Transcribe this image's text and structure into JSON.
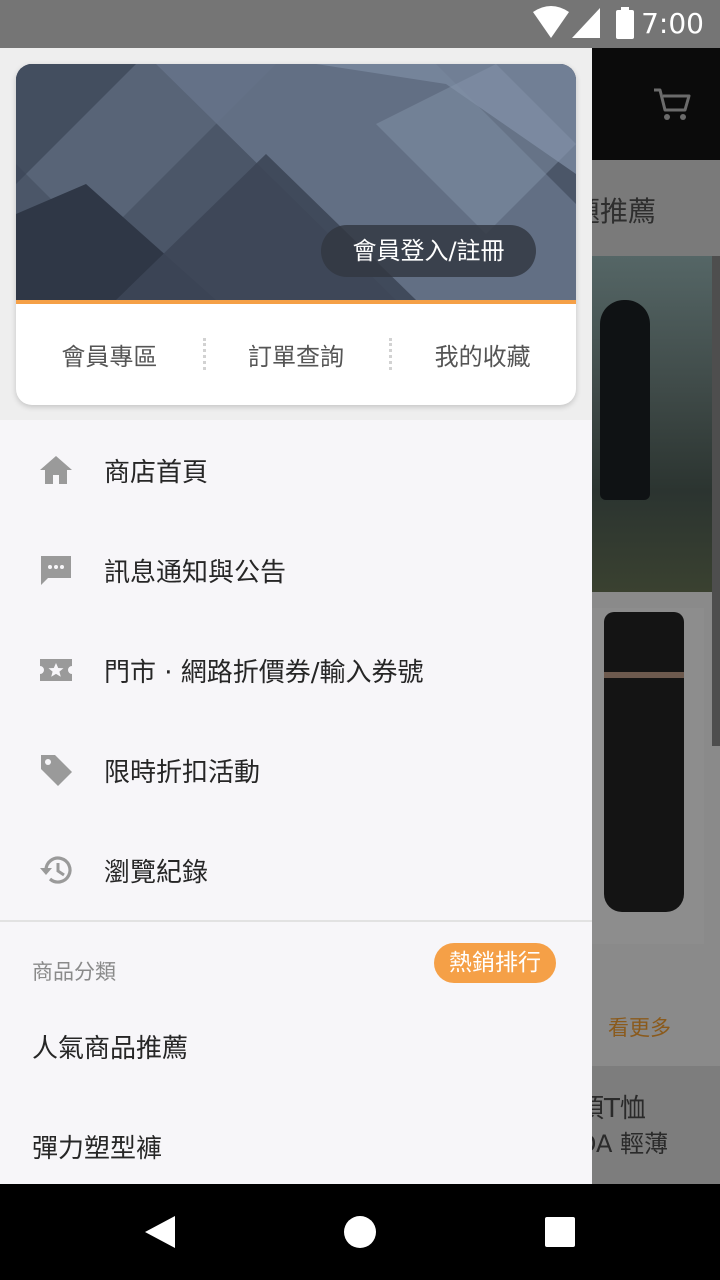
{
  "status_bar": {
    "time": "7:00",
    "icons": [
      "wifi-icon",
      "signal-icon",
      "battery-icon"
    ]
  },
  "background_app": {
    "tab_text": "題推薦",
    "see_more": "看更多",
    "product_line1": "頂T恤",
    "product_line2": "DA 輕薄",
    "accent_color": "#f5a047"
  },
  "drawer": {
    "profile": {
      "login_label": "會員登入/註冊",
      "quick_links": [
        {
          "label": "會員專區"
        },
        {
          "label": "訂單查詢"
        },
        {
          "label": "我的收藏"
        }
      ]
    },
    "menu": [
      {
        "label": "商店首頁",
        "icon": "home-icon"
      },
      {
        "label": "訊息通知與公告",
        "icon": "message-icon"
      },
      {
        "label": "門市 · 網路折價券/輸入券號",
        "icon": "coupon-icon"
      },
      {
        "label": "限時折扣活動",
        "icon": "tag-icon"
      },
      {
        "label": "瀏覽紀錄",
        "icon": "history-icon"
      }
    ],
    "categories": {
      "title": "商品分類",
      "hot_badge": "熱銷排行",
      "items": [
        {
          "label": "人氣商品推薦"
        },
        {
          "label": "彈力塑型褲"
        }
      ]
    }
  },
  "nav_bar": {
    "buttons": [
      "back-icon",
      "home-circle-icon",
      "recents-icon"
    ]
  }
}
